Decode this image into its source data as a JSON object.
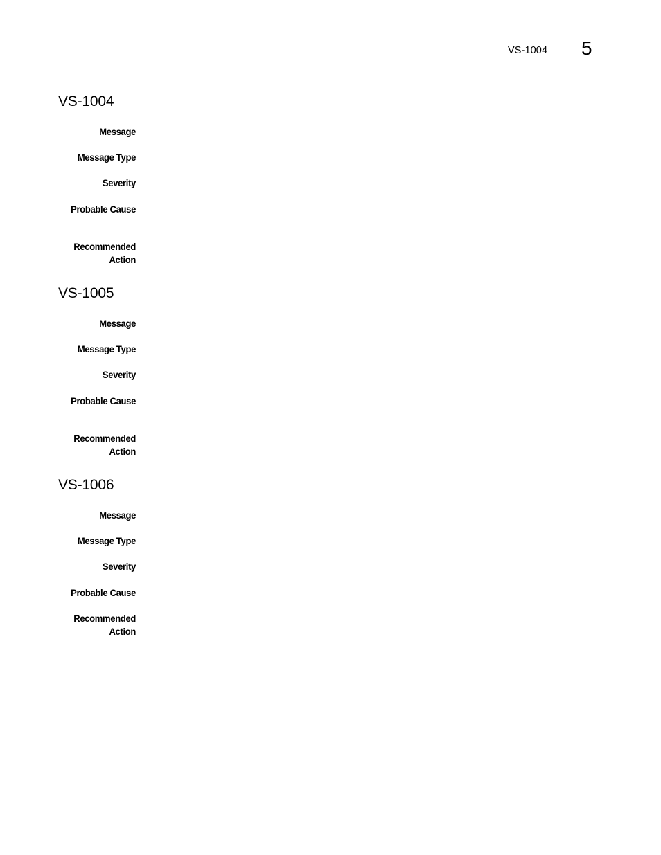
{
  "header": {
    "running_title": "VS-1004",
    "page_number": "5"
  },
  "sections": [
    {
      "title": "VS-1004",
      "fields": {
        "message": {
          "label": "Message",
          "value": ""
        },
        "message_type": {
          "label": "Message Type",
          "value": ""
        },
        "severity": {
          "label": "Severity",
          "value": ""
        },
        "probable_cause": {
          "label": "Probable Cause",
          "value": ""
        },
        "recommended_action": {
          "label_line1": "Recommended",
          "label_line2": "Action",
          "value": ""
        }
      }
    },
    {
      "title": "VS-1005",
      "fields": {
        "message": {
          "label": "Message",
          "value": ""
        },
        "message_type": {
          "label": "Message Type",
          "value": ""
        },
        "severity": {
          "label": "Severity",
          "value": ""
        },
        "probable_cause": {
          "label": "Probable Cause",
          "value": ""
        },
        "recommended_action": {
          "label_line1": "Recommended",
          "label_line2": "Action",
          "value": ""
        }
      }
    },
    {
      "title": "VS-1006",
      "fields": {
        "message": {
          "label": "Message",
          "value": ""
        },
        "message_type": {
          "label": "Message Type",
          "value": ""
        },
        "severity": {
          "label": "Severity",
          "value": ""
        },
        "probable_cause": {
          "label": "Probable Cause",
          "value": ""
        },
        "recommended_action": {
          "label_line1": "Recommended",
          "label_line2": "Action",
          "value": ""
        }
      }
    }
  ]
}
